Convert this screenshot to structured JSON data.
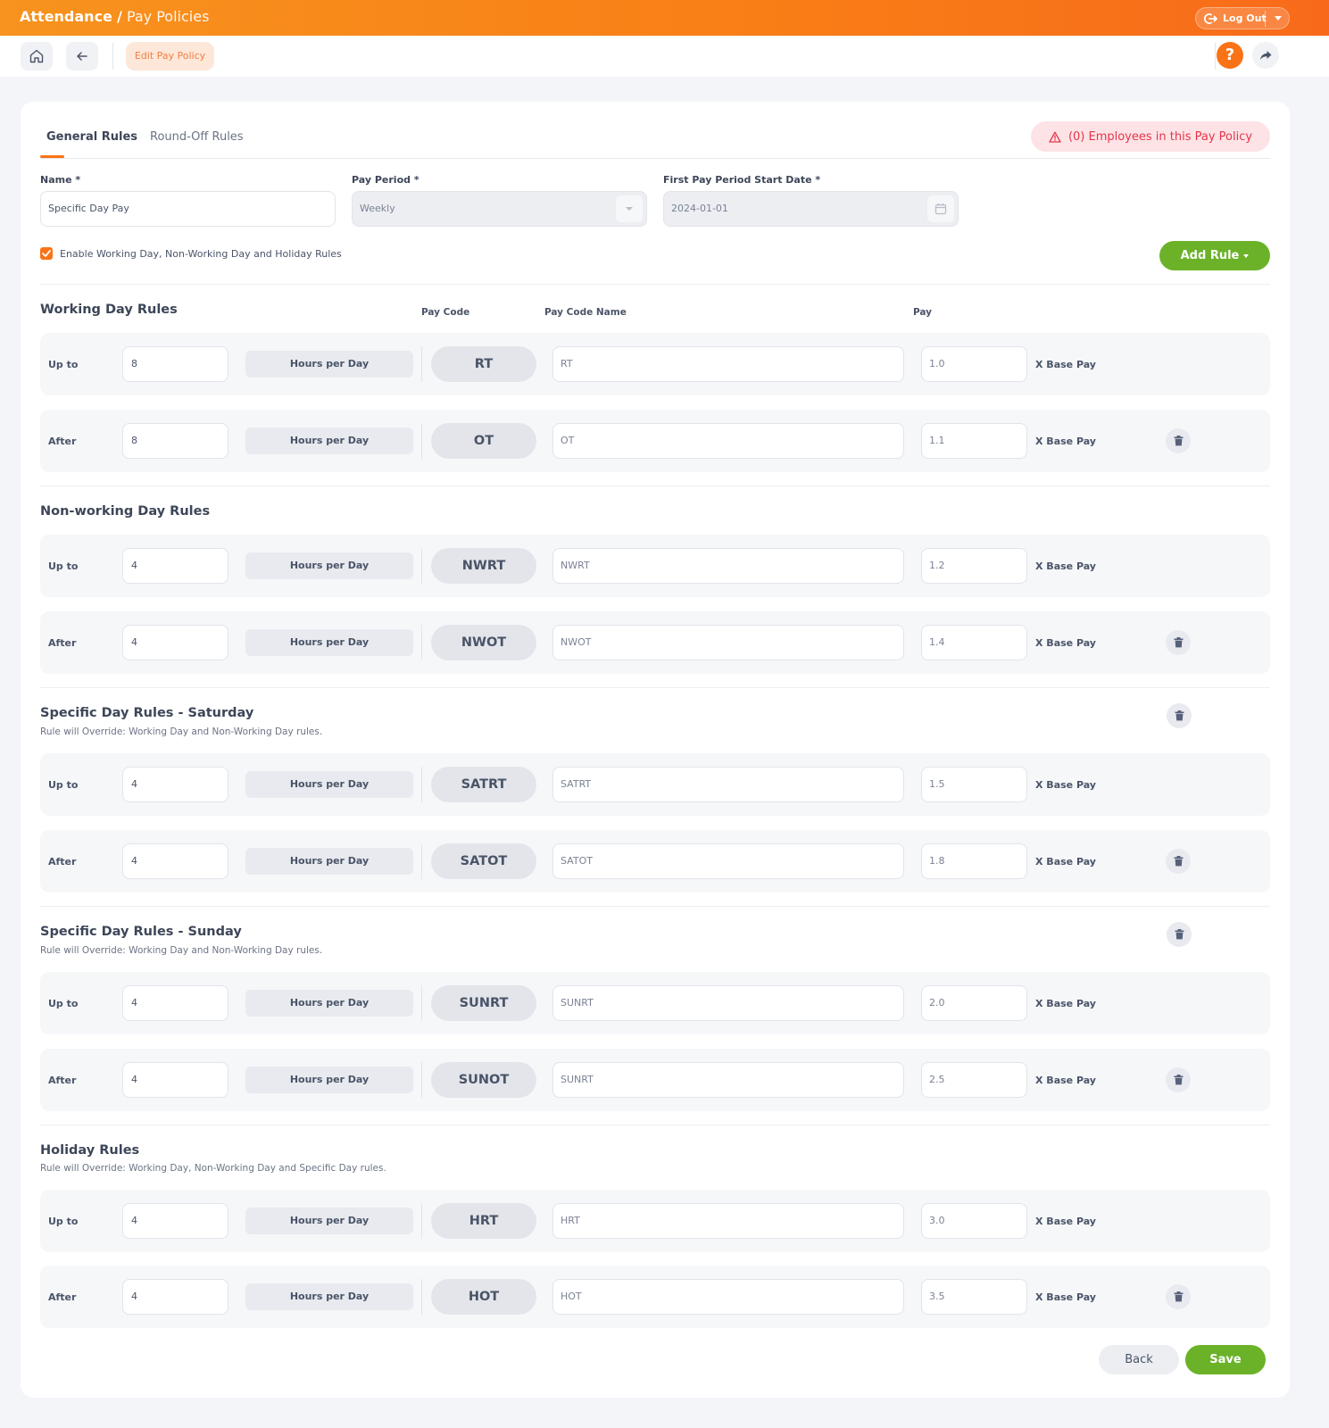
{
  "header": {
    "app": "Attendance",
    "separator": "/",
    "section": "Pay Policies",
    "logout_label": "Log Out"
  },
  "toolbar": {
    "breadcrumb_active": "Edit Pay Policy",
    "help_label": "?"
  },
  "tabs": [
    {
      "label": "General Rules",
      "active": true
    },
    {
      "label": "Round-Off Rules",
      "active": false
    }
  ],
  "employees_badge": "(0) Employees in this Pay Policy",
  "form": {
    "name_label": "Name *",
    "name_value": "Specific Day Pay",
    "pay_period_label": "Pay Period *",
    "pay_period_value": "Weekly",
    "start_date_label": "First Pay Period Start Date *",
    "start_date_value": "2024-01-01",
    "enable_rules_label": "Enable Working Day, Non-Working Day and Holiday Rules",
    "enable_rules_checked": true,
    "add_rule_label": "Add Rule"
  },
  "columns": {
    "pay_code": "Pay Code",
    "pay_code_name": "Pay Code Name",
    "pay": "Pay"
  },
  "sections": [
    {
      "title": "Working Day Rules",
      "subtitle": "",
      "rules": [
        {
          "condition": "Up to",
          "hours": "8",
          "unit": "Hours per Day",
          "code": "RT",
          "code_name": "RT",
          "pay": "1.0",
          "suffix": "X Base Pay",
          "deletable": false
        },
        {
          "condition": "After",
          "hours": "8",
          "unit": "Hours per Day",
          "code": "OT",
          "code_name": "OT",
          "pay": "1.1",
          "suffix": "X Base Pay",
          "deletable": true
        }
      ]
    },
    {
      "title": "Non-working Day Rules",
      "subtitle": "",
      "rules": [
        {
          "condition": "Up to",
          "hours": "4",
          "unit": "Hours per Day",
          "code": "NWRT",
          "code_name": "NWRT",
          "pay": "1.2",
          "suffix": "X Base Pay",
          "deletable": false
        },
        {
          "condition": "After",
          "hours": "4",
          "unit": "Hours per Day",
          "code": "NWOT",
          "code_name": "NWOT",
          "pay": "1.4",
          "suffix": "X Base Pay",
          "deletable": true
        }
      ]
    },
    {
      "title": "Specific Day Rules - Saturday",
      "subtitle": "Rule will Override: Working Day and Non-Working Day rules.",
      "rules": [
        {
          "condition": "Up to",
          "hours": "4",
          "unit": "Hours per Day",
          "code": "SATRT",
          "code_name": "SATRT",
          "pay": "1.5",
          "suffix": "X Base Pay",
          "deletable": false
        },
        {
          "condition": "After",
          "hours": "4",
          "unit": "Hours per Day",
          "code": "SATOT",
          "code_name": "SATOT",
          "pay": "1.8",
          "suffix": "X Base Pay",
          "deletable": true
        }
      ]
    },
    {
      "title": "Specific Day Rules - Sunday",
      "subtitle": "Rule will Override: Working Day and Non-Working Day rules.",
      "rules": [
        {
          "condition": "Up to",
          "hours": "4",
          "unit": "Hours per Day",
          "code": "SUNRT",
          "code_name": "SUNRT",
          "pay": "2.0",
          "suffix": "X Base Pay",
          "deletable": false
        },
        {
          "condition": "After",
          "hours": "4",
          "unit": "Hours per Day",
          "code": "SUNOT",
          "code_name": "SUNRT",
          "pay": "2.5",
          "suffix": "X Base Pay",
          "deletable": true
        }
      ]
    },
    {
      "title": "Holiday Rules",
      "subtitle": "Rule will Override: Working Day, Non-Working Day and Specific Day rules.",
      "rules": [
        {
          "condition": "Up to",
          "hours": "4",
          "unit": "Hours per Day",
          "code": "HRT",
          "code_name": "HRT",
          "pay": "3.0",
          "suffix": "X Base Pay",
          "deletable": false
        },
        {
          "condition": "After",
          "hours": "4",
          "unit": "Hours per Day",
          "code": "HOT",
          "code_name": "HOT",
          "pay": "3.5",
          "suffix": "X Base Pay",
          "deletable": true
        }
      ]
    }
  ],
  "footer": {
    "back_label": "Back",
    "save_label": "Save"
  },
  "colors": {
    "accent": "#f97316",
    "success": "#6bb229",
    "danger": "#e5354a"
  },
  "icons": {
    "home": "home-icon",
    "back": "arrow-left-icon",
    "logout": "logout-icon",
    "help": "help-icon",
    "share": "share-icon",
    "calendar": "calendar-icon",
    "dropdown": "chevron-down-icon",
    "warning": "warning-icon",
    "delete": "trash-icon"
  }
}
